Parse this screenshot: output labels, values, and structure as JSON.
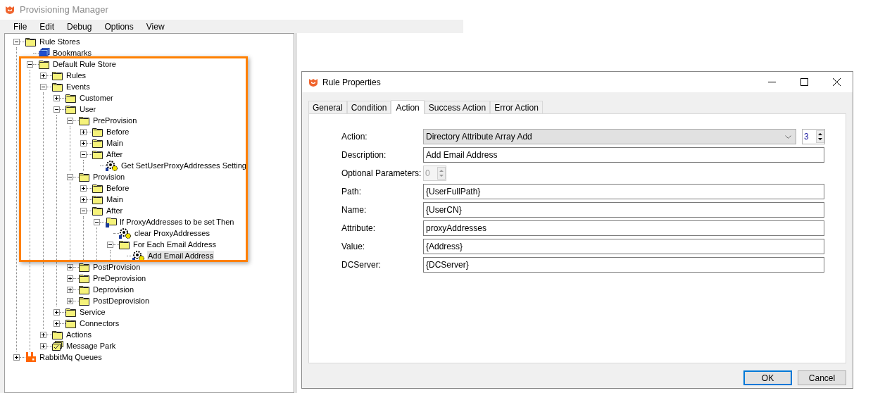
{
  "app": {
    "title": "Provisioning Manager"
  },
  "menu": [
    "File",
    "Edit",
    "Debug",
    "Options",
    "View"
  ],
  "tree": [
    {
      "label": "Rule Stores",
      "kind": "folder",
      "expanded": true,
      "selected": false,
      "children": [
        {
          "label": "Bookmarks",
          "kind": "bookmarks",
          "selected": false
        },
        {
          "label": "Default Rule Store",
          "kind": "folder",
          "expanded": true,
          "selected": false,
          "children": [
            {
              "label": "Rules",
              "kind": "folder",
              "expanded": false,
              "selected": false
            },
            {
              "label": "Events",
              "kind": "folder",
              "expanded": true,
              "selected": false,
              "children": [
                {
                  "label": "Customer",
                  "kind": "folder",
                  "expanded": false,
                  "selected": false
                },
                {
                  "label": "User",
                  "kind": "folder",
                  "expanded": true,
                  "selected": false,
                  "children": [
                    {
                      "label": "PreProvision",
                      "kind": "folder",
                      "expanded": true,
                      "selected": false,
                      "children": [
                        {
                          "label": "Before",
                          "kind": "folder",
                          "expanded": false,
                          "selected": false
                        },
                        {
                          "label": "Main",
                          "kind": "folder",
                          "expanded": false,
                          "selected": false
                        },
                        {
                          "label": "After",
                          "kind": "folder",
                          "expanded": true,
                          "selected": false,
                          "children": [
                            {
                              "label": "Get SetUserProxyAddresses Setting",
                              "kind": "rule",
                              "selected": false
                            }
                          ]
                        }
                      ]
                    },
                    {
                      "label": "Provision",
                      "kind": "folder",
                      "expanded": true,
                      "selected": false,
                      "children": [
                        {
                          "label": "Before",
                          "kind": "folder",
                          "expanded": false,
                          "selected": false
                        },
                        {
                          "label": "Main",
                          "kind": "folder",
                          "expanded": false,
                          "selected": false
                        },
                        {
                          "label": "After",
                          "kind": "folder",
                          "expanded": true,
                          "selected": false,
                          "children": [
                            {
                              "label": "If ProxyAddresses to be set Then",
                              "kind": "condition",
                              "expanded": true,
                              "selected": false,
                              "children": [
                                {
                                  "label": "clear ProxyAddresses",
                                  "kind": "rule",
                                  "selected": false
                                },
                                {
                                  "label": "For Each Email Address",
                                  "kind": "folder",
                                  "expanded": true,
                                  "selected": false,
                                  "children": [
                                    {
                                      "label": "Add Email Address",
                                      "kind": "rule",
                                      "selected": true
                                    }
                                  ]
                                }
                              ]
                            }
                          ]
                        }
                      ]
                    },
                    {
                      "label": "PostProvision",
                      "kind": "folder",
                      "expanded": false,
                      "selected": false
                    },
                    {
                      "label": "PreDeprovision",
                      "kind": "folder",
                      "expanded": false,
                      "selected": false
                    },
                    {
                      "label": "Deprovision",
                      "kind": "folder",
                      "expanded": false,
                      "selected": false
                    },
                    {
                      "label": "PostDeprovision",
                      "kind": "folder",
                      "expanded": false,
                      "selected": false
                    }
                  ]
                },
                {
                  "label": "Service",
                  "kind": "folder",
                  "expanded": false,
                  "selected": false
                },
                {
                  "label": "Connectors",
                  "kind": "folder",
                  "expanded": false,
                  "selected": false
                }
              ]
            },
            {
              "label": "Actions",
              "kind": "folder",
              "expanded": false,
              "selected": false
            },
            {
              "label": "Message Park",
              "kind": "message-park",
              "expanded": false,
              "selected": false
            }
          ]
        }
      ]
    },
    {
      "label": "RabbitMq Queues",
      "kind": "rabbit",
      "expanded": false,
      "selected": false
    }
  ],
  "dialog": {
    "title": "Rule Properties",
    "tabs": [
      {
        "label": "General",
        "selected": false
      },
      {
        "label": "Condition",
        "selected": false
      },
      {
        "label": "Action",
        "selected": true
      },
      {
        "label": "Success Action",
        "selected": false
      },
      {
        "label": "Error Action",
        "selected": false
      }
    ],
    "fields": [
      {
        "label": "Action:",
        "kind": "combo",
        "value": "Directory Attribute Array Add",
        "spin_value": "3",
        "disabled": false
      },
      {
        "label": "Description:",
        "kind": "text",
        "value": "Add Email Address",
        "disabled": false
      },
      {
        "label": "Optional Parameters:",
        "kind": "spin",
        "value": "0",
        "disabled": true
      },
      {
        "label": "Path:",
        "kind": "text",
        "value": "{UserFullPath}",
        "disabled": false
      },
      {
        "label": "Name:",
        "kind": "text",
        "value": "{UserCN}",
        "disabled": false
      },
      {
        "label": "Attribute:",
        "kind": "text",
        "value": "proxyAddresses",
        "disabled": false
      },
      {
        "label": "Value:",
        "kind": "text",
        "value": "{Address}",
        "disabled": false
      },
      {
        "label": "DCServer:",
        "kind": "text",
        "value": "{DCServer}",
        "disabled": false
      }
    ],
    "buttons": [
      {
        "label": "OK",
        "default": true
      },
      {
        "label": "Cancel",
        "default": false
      }
    ]
  }
}
